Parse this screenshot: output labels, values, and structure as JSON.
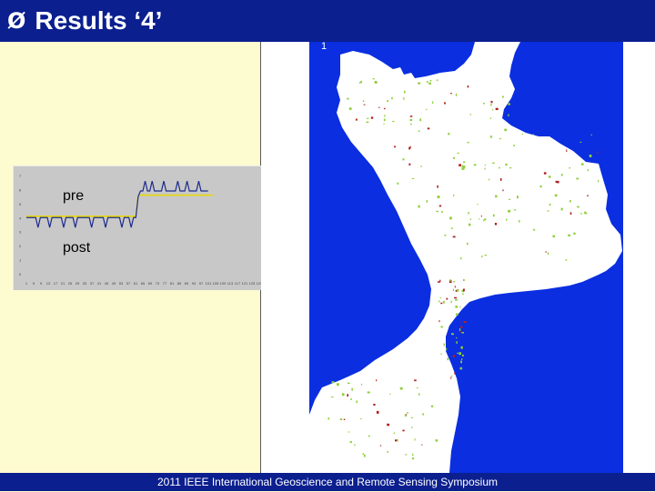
{
  "slide": {
    "bullet": "Ø",
    "title": "Results ‘4’",
    "footer": "2011 IEEE International Geoscience and Remote Sensing Symposium"
  },
  "map": {
    "label": "1",
    "colors": {
      "sea": "#0a2ee0",
      "land": "#ffffff",
      "vegetation": "#8fcf3a",
      "burned": "#b02020"
    }
  },
  "chart": {
    "labels": {
      "pre": "pre",
      "post": "post"
    },
    "colors": {
      "series": "#1c2a8c",
      "threshold": "#e6d800",
      "background": "#c8c8c8"
    }
  },
  "chart_data": {
    "type": "line",
    "y_ticks": [
      "7",
      "6",
      "5",
      "4",
      "3",
      "2",
      "1",
      "0"
    ],
    "ylim": [
      0,
      7
    ],
    "x_ticks": [
      "1",
      "5",
      "9",
      "13",
      "17",
      "21",
      "25",
      "29",
      "33",
      "37",
      "41",
      "45",
      "49",
      "53",
      "57",
      "61",
      "65",
      "69",
      "73",
      "77",
      "81",
      "85",
      "89",
      "93",
      "97",
      "101",
      "105",
      "109",
      "113",
      "117",
      "121",
      "125",
      "129"
    ],
    "annotations": [
      "pre",
      "post"
    ]
  }
}
